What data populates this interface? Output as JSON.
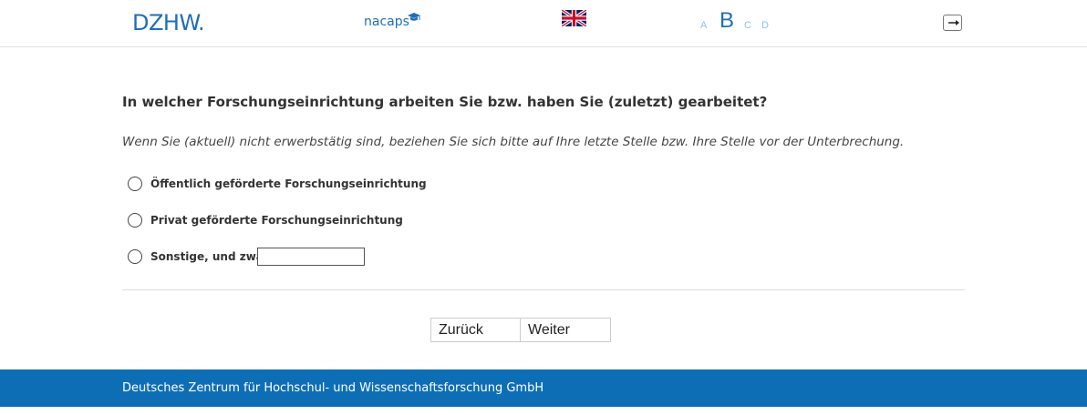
{
  "header": {
    "logo_primary": "DZHW.",
    "logo_secondary": "nacaps",
    "language_flag_icon": "uk-flag-icon",
    "font_sizes": [
      "A",
      "B",
      "C",
      "D"
    ],
    "font_size_selected": "B",
    "logout_icon": "logout-icon"
  },
  "question": {
    "title": "In welcher Forschungseinrichtung arbeiten Sie bzw. haben Sie (zuletzt) gearbeitet?",
    "instruction": "Wenn Sie (aktuell) nicht erwerbstätig sind, beziehen Sie sich bitte auf Ihre letzte Stelle bzw. Ihre Stelle vor der Unterbrechung.",
    "options": [
      {
        "label": "Öffentlich geförderte Forschungseinrichtung"
      },
      {
        "label": "Privat geförderte Forschungseinrichtung"
      },
      {
        "label": "Sonstige, und zwar:"
      }
    ],
    "other_value": ""
  },
  "navigation": {
    "back_label": "Zurück",
    "next_label": "Weiter"
  },
  "footer": {
    "text": "Deutsches Zentrum für Hochschul- und Wissenschaftsforschung GmbH"
  },
  "colors": {
    "brand_blue": "#1f6eb7",
    "footer_blue": "#0e6eb5",
    "font_size_inactive": "#8cc2e8"
  }
}
